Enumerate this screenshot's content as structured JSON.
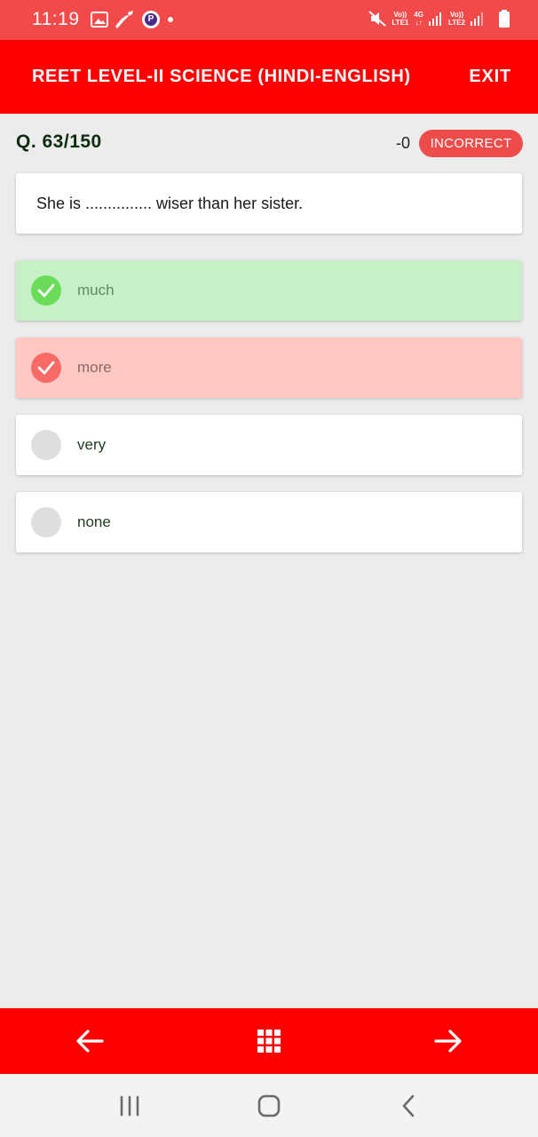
{
  "status_bar": {
    "time": "11:19",
    "icons_left": [
      "image-icon",
      "broom-icon",
      "p-app-icon",
      "dot-icon"
    ],
    "p_letter": "P",
    "network": {
      "sim1": [
        "Vo))",
        "LTE1"
      ],
      "sim1_type": "4G",
      "sim2": [
        "Vo))",
        "LTE2"
      ]
    },
    "icons_right": [
      "mute-icon",
      "signal-icon",
      "battery-icon"
    ]
  },
  "header": {
    "title": "REET LEVEL-II SCIENCE (HINDI-ENGLISH)",
    "exit_label": "EXIT",
    "color": "#ff0000"
  },
  "question": {
    "number": "Q. 63/150",
    "score": "-0",
    "status": "INCORRECT",
    "text": "She is ............... wiser than her sister."
  },
  "options": [
    {
      "label": "much",
      "state": "correct"
    },
    {
      "label": "more",
      "state": "selected-wrong"
    },
    {
      "label": "very",
      "state": "none"
    },
    {
      "label": "none",
      "state": "none"
    }
  ],
  "bottom_nav": {
    "icons": [
      "arrow-left-icon",
      "grid-icon",
      "arrow-right-icon"
    ]
  },
  "system_nav": {
    "icons": [
      "recent-apps-icon",
      "home-icon",
      "back-icon"
    ]
  },
  "colors": {
    "status_bar": "#f24a4a",
    "accent": "#ff0000",
    "correct_bg": "#c8f0c8",
    "correct_check": "#6bdc5a",
    "wrong_bg": "#ffc8c2",
    "wrong_check": "#f76a66",
    "badge": "#ee4b4b"
  }
}
